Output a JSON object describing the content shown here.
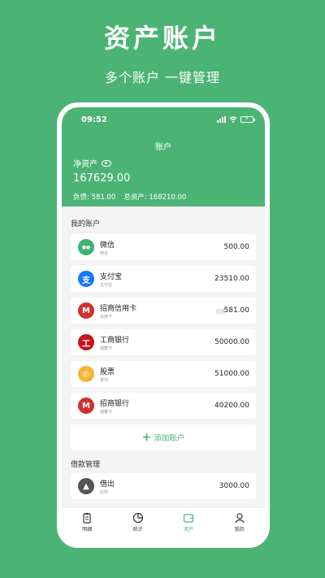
{
  "promo": {
    "title": "资产账户",
    "subtitle": "多个账户 一键管理"
  },
  "status_bar": {
    "time": "09:52"
  },
  "header": {
    "title": "账户",
    "net_assets_label": "净资产",
    "net_assets_value": "167629.00",
    "liabilities": "负债: 581.00",
    "total_assets": "总资产: 168210.00"
  },
  "accounts_section": {
    "title": "我的账户",
    "items": [
      {
        "name": "微信",
        "sub": "微信",
        "amount": "500.00",
        "note": "",
        "icon": "wechat-icon",
        "color": "#3cb371"
      },
      {
        "name": "支付宝",
        "sub": "支付宝",
        "amount": "23510.00",
        "note": "",
        "icon": "alipay-icon",
        "color": "#1677ff"
      },
      {
        "name": "招商信用卡",
        "sub": "信用卡",
        "amount": "581.00",
        "note": "应还",
        "icon": "cmb-icon",
        "color": "#d0312d"
      },
      {
        "name": "工商银行",
        "sub": "储蓄卡",
        "amount": "50000.00",
        "note": "",
        "icon": "icbc-icon",
        "color": "#c4161c"
      },
      {
        "name": "股票",
        "sub": "其他",
        "amount": "51000.00",
        "note": "",
        "icon": "coins-icon",
        "color": "#f2b632"
      },
      {
        "name": "招商银行",
        "sub": "储蓄卡",
        "amount": "40200.00",
        "note": "",
        "icon": "cmb-icon",
        "color": "#d0312d"
      }
    ],
    "add_label": "添加账户"
  },
  "loan_section": {
    "title": "借款管理",
    "items": [
      {
        "name": "借出",
        "sub": "应收",
        "amount": "3000.00",
        "icon": "arrow-up-icon",
        "color": "#555555"
      }
    ]
  },
  "tabbar": {
    "items": [
      {
        "label": "明细",
        "icon": "clipboard-icon",
        "active": false
      },
      {
        "label": "统计",
        "icon": "pie-chart-icon",
        "active": false
      },
      {
        "label": "资产",
        "icon": "wallet-icon",
        "active": true
      },
      {
        "label": "我的",
        "icon": "user-icon",
        "active": false
      }
    ]
  },
  "colors": {
    "brand": "#4bb474",
    "background": "#f4f4f4"
  }
}
